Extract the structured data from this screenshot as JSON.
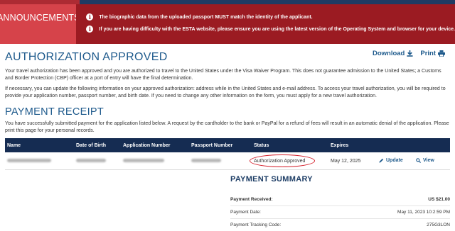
{
  "announcements": {
    "label": "ANNOUNCEMENTS",
    "items": [
      "The biographic data from the uploaded passport MUST match the identity of the applicant.",
      "If you are having difficulty with the ESTA website, please ensure you are using the latest version of the Operating System and browser for your device."
    ]
  },
  "authorization": {
    "title": "AUTHORIZATION APPROVED",
    "download_label": "Download",
    "print_label": "Print",
    "paragraph1": "Your travel authorization has been approved and you are authorized to travel to the United States under the Visa Waiver Program. This does not guarantee admission to the United States; a Customs and Border Protection (CBP) officer at a port of entry will have the final determination.",
    "paragraph2": "If necessary, you can update the following information on your approved authorization: address while in the United States and e-mail address. To access your travel authorization, you will be required to provide your application number, passport number, and birth date. If you need to change any other information on the form, you must apply for a new travel authorization."
  },
  "receipt": {
    "title": "PAYMENT RECEIPT",
    "paragraph": "You have successfully submitted payment for the application listed below. A request by the cardholder to the bank or PayPal for a refund of fees will result in an automatic denial of the application. Please print this page for your personal records.",
    "columns": [
      "Name",
      "Date of Birth",
      "Application Number",
      "Passport Number",
      "Status",
      "Expires",
      "",
      ""
    ],
    "row": {
      "status": "Authorization Approved",
      "expires": "May 12, 2025",
      "update_label": "Update",
      "view_label": "View"
    }
  },
  "summary": {
    "title": "PAYMENT SUMMARY",
    "rows": [
      {
        "label": "Payment Received:",
        "value": "US $21.00"
      },
      {
        "label": "Payment Date:",
        "value": "May 11, 2023 10:2:59 PM"
      },
      {
        "label": "Payment Tracking Code:",
        "value": "275G3LON"
      }
    ]
  },
  "colors": {
    "announce_label_bg": "#d6434a",
    "announce_bg": "#9b1b22",
    "heading_blue": "#1e5a8c",
    "table_header_bg": "#152c52",
    "status_ring": "#d41f2a"
  }
}
